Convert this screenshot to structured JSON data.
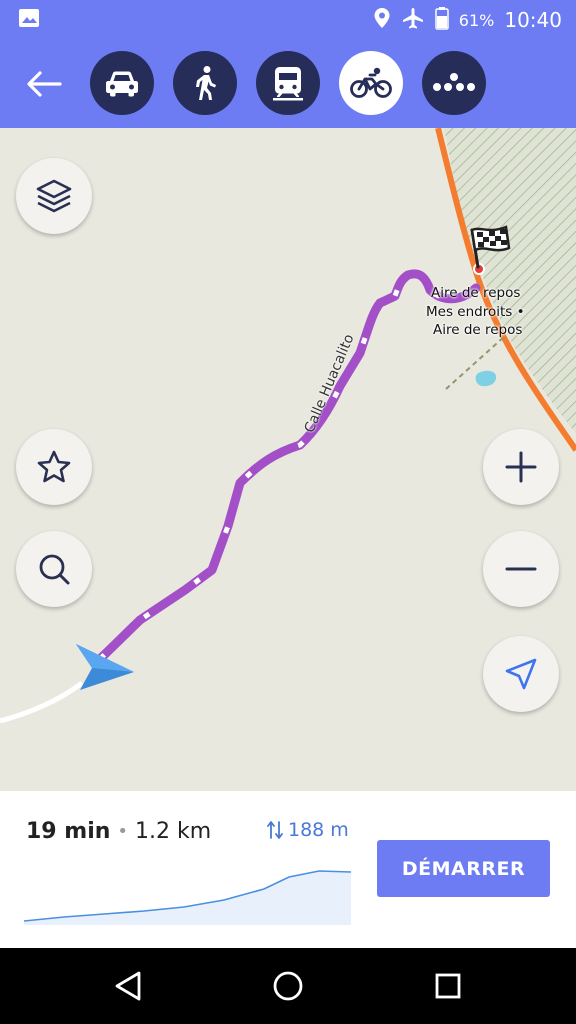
{
  "status_bar": {
    "battery": "61%",
    "time": "10:40",
    "icons": [
      "gallery-icon",
      "location-icon",
      "airplane-icon",
      "battery-icon"
    ]
  },
  "toolbar": {
    "back_icon": "arrow-left-icon",
    "modes": [
      {
        "name": "car",
        "icon": "car-icon",
        "selected": false
      },
      {
        "name": "walk",
        "icon": "pedestrian-icon",
        "selected": false
      },
      {
        "name": "transit",
        "icon": "train-icon",
        "selected": false
      },
      {
        "name": "bike",
        "icon": "bicycle-icon",
        "selected": true
      },
      {
        "name": "more",
        "icon": "more-dots-icon",
        "selected": false
      }
    ],
    "accent_color": "#6d7cf2",
    "button_color": "#252d58"
  },
  "map": {
    "street_name": "Calle Huacalito",
    "poi_name": "Aire de repos",
    "poi_list_line1": "Mes endroits •",
    "poi_list_line2": "Aire de repos",
    "route_color": "#a24fc8",
    "highway_color": "#f47c2f",
    "buttons": [
      "layers-icon",
      "star-icon",
      "search-icon",
      "zoom-in-icon",
      "zoom-out-icon",
      "my-location-icon"
    ]
  },
  "route_summary": {
    "duration": "19 min",
    "separator": "•",
    "distance": "1.2 km",
    "elevation": "188 m",
    "start_label": "DÉMARRER"
  },
  "nav_bar": {
    "buttons": [
      "back-triangle-icon",
      "home-circle-icon",
      "recents-square-icon"
    ]
  }
}
